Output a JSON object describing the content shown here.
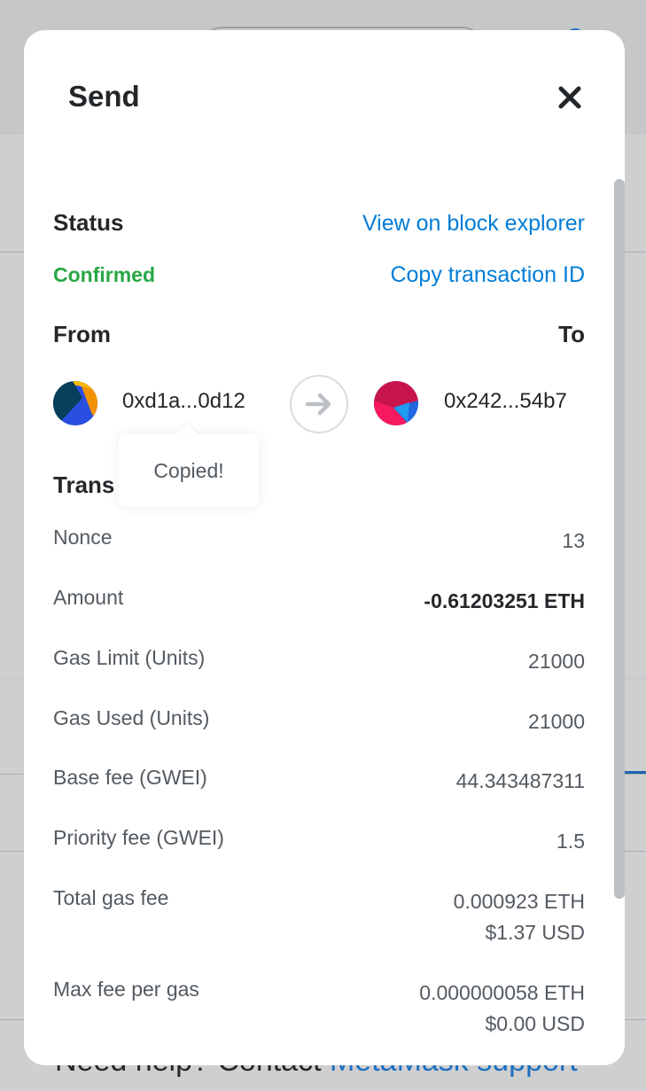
{
  "background": {
    "help_prefix": "Need help? Contact ",
    "help_link": "MetaMask support"
  },
  "modal": {
    "title": "Send",
    "close_icon": "close-icon",
    "status_label": "Status",
    "status_value": "Confirmed",
    "status_color": "#28a745",
    "view_explorer_link": "View on block explorer",
    "copy_tx_link": "Copy transaction ID",
    "from_label": "From",
    "to_label": "To",
    "from_address": "0xd1a...0d12",
    "to_address": "0x242...54b7",
    "arrow_icon": "arrow-right-icon",
    "tooltip_text": "Copied!",
    "transaction_heading": "Trans",
    "details": [
      {
        "label": "Nonce",
        "value": "13"
      },
      {
        "label": "Amount",
        "value": "-0.61203251 ETH"
      },
      {
        "label": "Gas Limit (Units)",
        "value": "21000"
      },
      {
        "label": "Gas Used (Units)",
        "value": "21000"
      },
      {
        "label": "Base fee (GWEI)",
        "value": "44.343487311"
      },
      {
        "label": "Priority fee (GWEI)",
        "value": "1.5"
      },
      {
        "label": "Total gas fee",
        "value": "0.000923 ETH",
        "value_usd": "$1.37 USD"
      },
      {
        "label": "Max fee per gas",
        "value": "0.000000058 ETH",
        "value_usd": "$0.00 USD"
      }
    ]
  },
  "colors": {
    "link": "#037dd6",
    "text_primary": "#24272a",
    "text_secondary": "#535a61"
  }
}
